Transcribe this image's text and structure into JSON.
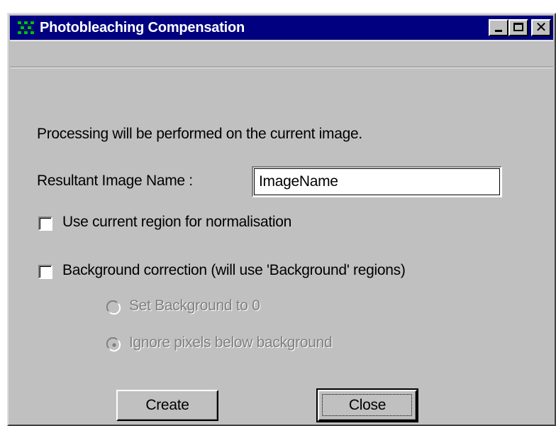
{
  "window": {
    "title": "Photobleaching Compensation",
    "controls": {
      "minimize": "_",
      "maximize": "□",
      "close": "✕"
    }
  },
  "dialog": {
    "info_text": "Processing will be performed on the current image.",
    "name_label": "Resultant Image Name :",
    "name_value": "ImageName",
    "use_region_label": "Use current region for normalisation",
    "use_region_checked": false,
    "background_label": "Background correction (will use 'Background' regions)",
    "background_checked": false,
    "radio_set_zero_label": "Set Background to 0",
    "radio_set_zero_selected": false,
    "radio_ignore_label": "Ignore pixels below background",
    "radio_ignore_selected": true,
    "radios_enabled": false,
    "create_label": "Create",
    "close_label": "Close"
  },
  "colors": {
    "titlebar": "#000080",
    "face": "#c0c0c0",
    "disabled_text": "#808080",
    "icon_green": "#00c000"
  },
  "icons": {
    "app": "photobleaching-app-icon"
  }
}
